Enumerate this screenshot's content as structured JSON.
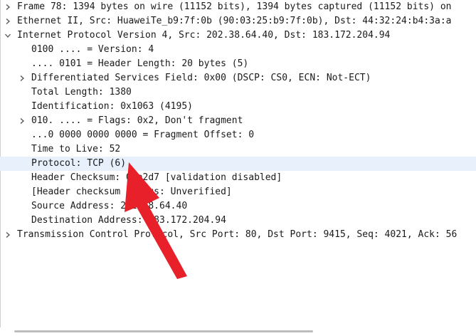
{
  "rows": [
    {
      "text": "Frame 78: 1394 bytes on wire (11152 bits), 1394 bytes captured (11152 bits) on",
      "expander": "collapsed"
    },
    {
      "text": "Ethernet II, Src: HuaweiTe_b9:7f:0b (90:03:25:b9:7f:0b), Dst: 44:32:24:b4:3a:a",
      "expander": "collapsed"
    },
    {
      "text": "Internet Protocol Version 4, Src: 202.38.64.40, Dst: 183.172.204.94",
      "expander": "expanded"
    },
    {
      "text": "0100 .... = Version: 4",
      "expander": "none"
    },
    {
      "text": ".... 0101 = Header Length: 20 bytes (5)",
      "expander": "none"
    },
    {
      "text": "Differentiated Services Field: 0x00 (DSCP: CS0, ECN: Not-ECT)",
      "expander": "collapsed"
    },
    {
      "text": "Total Length: 1380",
      "expander": "none"
    },
    {
      "text": "Identification: 0x1063 (4195)",
      "expander": "none"
    },
    {
      "text": "010. .... = Flags: 0x2, Don't fragment",
      "expander": "collapsed"
    },
    {
      "text": "...0 0000 0000 0000 = Fragment Offset: 0",
      "expander": "none"
    },
    {
      "text": "Time to Live: 52",
      "expander": "none"
    },
    {
      "text": "Protocol: TCP (6)",
      "expander": "none",
      "selected": true
    },
    {
      "text": "Header Checksum: 0xa2d7 [validation disabled]",
      "expander": "none"
    },
    {
      "text": "[Header checksum status: Unverified]",
      "expander": "none"
    },
    {
      "text": "Source Address: 202.38.64.40",
      "expander": "none"
    },
    {
      "text": "Destination Address: 183.172.204.94",
      "expander": "none"
    },
    {
      "text": "Transmission Control Protocol, Src Port: 80, Dst Port: 9415, Seq: 4021, Ack: 56",
      "expander": "collapsed"
    }
  ],
  "colors": {
    "selected_row": "#e8f1fb",
    "annotation_arrow": "#e8202a"
  },
  "icons": {
    "collapsed": "chevron-right-icon",
    "expanded": "chevron-down-icon"
  }
}
